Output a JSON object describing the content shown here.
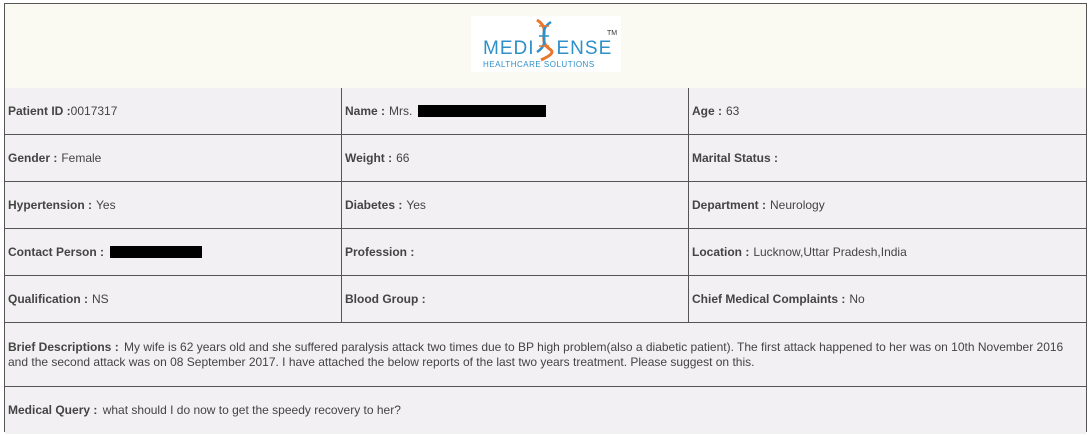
{
  "logo": {
    "brand_left": "MEDI",
    "brand_right": "ENSE",
    "trademark": "TM",
    "tagline": "HEALTHCARE SOLUTIONS"
  },
  "rows": [
    [
      {
        "label": "Patient ID :",
        "value": "0017317",
        "redacted": false
      },
      {
        "label": "Name :",
        "value": "Mrs.",
        "redacted": true
      },
      {
        "label": "Age :",
        "value": "63",
        "redacted": false
      }
    ],
    [
      {
        "label": "Gender :",
        "value": "Female",
        "redacted": false
      },
      {
        "label": "Weight :",
        "value": "66",
        "redacted": false
      },
      {
        "label": "Marital Status :",
        "value": "",
        "redacted": false
      }
    ],
    [
      {
        "label": "Hypertension :",
        "value": "Yes",
        "redacted": false
      },
      {
        "label": "Diabetes :",
        "value": "Yes",
        "redacted": false
      },
      {
        "label": "Department :",
        "value": "Neurology",
        "redacted": false
      }
    ],
    [
      {
        "label": "Contact Person :",
        "value": "",
        "redacted": true
      },
      {
        "label": "Profession :",
        "value": "",
        "redacted": false
      },
      {
        "label": "Location :",
        "value": "Lucknow,Uttar Pradesh,India",
        "redacted": false
      }
    ],
    [
      {
        "label": "Qualification :",
        "value": "NS",
        "redacted": false
      },
      {
        "label": "Blood Group :",
        "value": "",
        "redacted": false
      },
      {
        "label": "Chief Medical Complaints :",
        "value": "No",
        "redacted": false
      }
    ]
  ],
  "brief": {
    "label": "Brief Descriptions :",
    "value": "My wife is 62 years old and she suffered paralysis attack two times due to BP high problem(also a diabetic patient). The first attack happened to her was on 10th November 2016 and the second attack was on 08 September 2017. I have attached the below reports of the last two years treatment. Please suggest on this."
  },
  "query": {
    "label": "Medical Query :",
    "value": "what should I do now to get the speedy recovery to her?"
  },
  "colors": {
    "brand_blue": "#2e8fc9",
    "brand_orange": "#e8772e",
    "border": "#555555",
    "cell_bg": "#f2f0f2"
  }
}
